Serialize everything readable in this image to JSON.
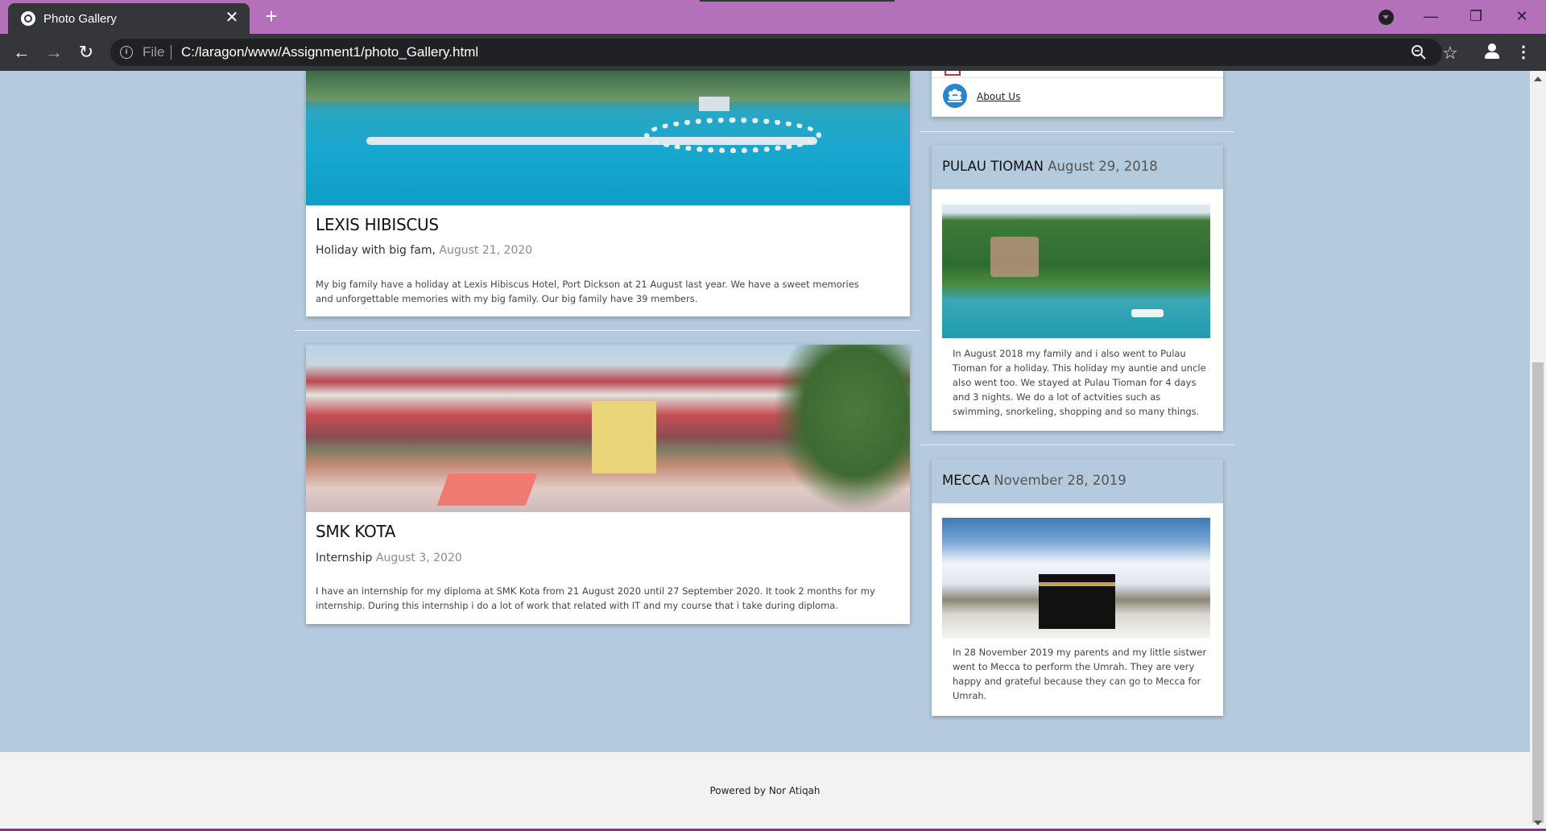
{
  "browser": {
    "tab_title": "Photo Gallery",
    "tab_close": "✕",
    "new_tab": "+",
    "address_scheme": "File",
    "address_url": "C:/laragon/www/Assignment1/photo_Gallery.html",
    "window_minimize": "—",
    "window_restore": "❐",
    "window_close": "✕",
    "back": "←",
    "forward": "→",
    "reload": "↻",
    "zoom_icon": "🔍",
    "star_icon": "☆",
    "menu_icon": "⋮"
  },
  "posts": [
    {
      "title": "LEXIS HIBISCUS",
      "subtitle": "Holiday with big fam,",
      "date": "August 21, 2020",
      "body": "My big family have a holiday at Lexis Hibiscus Hotel, Port Dickson at 21 August last year. We have a sweet memories and unforgettable memories with my big family. Our big family have 39 members."
    },
    {
      "title": "SMK KOTA",
      "subtitle": "Internship",
      "date": "August 3, 2020",
      "body": "I have an internship for my diploma at SMK Kota from 21 August 2020 until 27 September 2020. It took 2 months for my internship. During this internship i do a lot of work that related with IT and my course that i take during diploma."
    }
  ],
  "sidebar": {
    "about_link": "About Us",
    "cards": [
      {
        "place": "PULAU TIOMAN",
        "date": "August 29, 2018",
        "body": "In August 2018 my family and i also went to Pulau Tioman for a holiday. This holiday my auntie and uncle also went too. We stayed at Pulau Tioman for 4 days and 3 nights. We do a lot of actvities such as swimming, snorkeling, shopping and so many things."
      },
      {
        "place": "MECCA",
        "date": "November 28, 2019",
        "body": "In 28 November 2019 my parents and my little sistwer went to Mecca to perform the Umrah. They are very happy and grateful because they can go to Mecca for Umrah."
      }
    ]
  },
  "footer": {
    "text": "Powered by Nor Atiqah"
  },
  "colors": {
    "tab_strip": "#b271b8",
    "toolbar": "#35363a",
    "page_bg": "#b4cadd",
    "card_bg": "#ffffff",
    "footer_bg": "#f2f2f2"
  }
}
